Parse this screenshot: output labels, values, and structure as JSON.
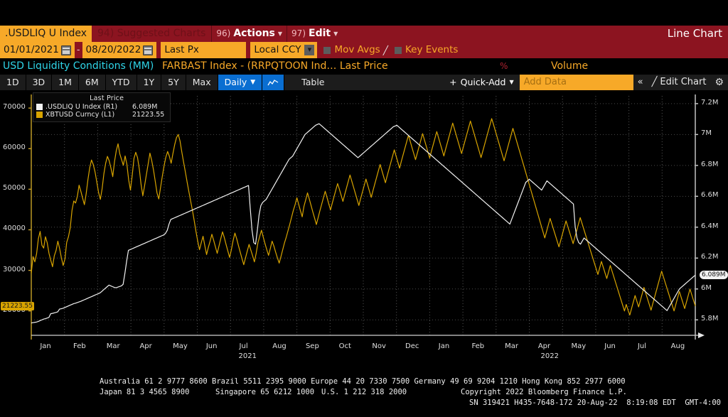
{
  "header": {
    "ticker": ".USDLIQ U Index",
    "suggested_charts": "94) Suggested Charts",
    "actions_num": "96)",
    "actions_label": "Actions",
    "edit_num": "97)",
    "edit_label": "Edit",
    "right_label": "Line Chart"
  },
  "options": {
    "date_from": "01/01/2021",
    "date_sep": "-",
    "date_to": "08/20/2022",
    "price_type": "Last Px",
    "currency": "Local CCY",
    "mov_avgs": "Mov Avgs",
    "key_events": "Key Events"
  },
  "titles": {
    "left": "USD Liquidity Conditions (MM)",
    "center": "FARBAST Index - (RRPQTOON Ind…  Last Price",
    "percent": "%",
    "volume": "Volume"
  },
  "toolbar": {
    "periods": [
      "1D",
      "3D",
      "1M",
      "6M",
      "YTD",
      "1Y",
      "5Y",
      "Max"
    ],
    "interval": "Daily",
    "chart_icon": "line-chart-icon",
    "table": "Table",
    "quick_add": "Quick-Add",
    "add_data_placeholder": "Add Data",
    "collapse": "«",
    "edit_chart": "Edit Chart",
    "settings": "gear-icon"
  },
  "legend": {
    "header": "Last Price",
    "series": [
      {
        "color": "#f2f2f2",
        "name": ".USDLIQ U Index  (R1)",
        "value": "6.089M"
      },
      {
        "color": "#d8a400",
        "name": "XBTUSD Curncy  (L1)",
        "value": "21223.55"
      }
    ]
  },
  "axes": {
    "left_ticks": [
      "70000",
      "60000",
      "50000",
      "40000",
      "30000",
      "20000"
    ],
    "right_ticks": [
      "7.2M",
      "7M",
      "6.8M",
      "6.6M",
      "6.4M",
      "6.2M",
      "6M",
      "5.8M"
    ],
    "left_tag": "21223.55",
    "right_tag": "6.089M",
    "x_ticks": [
      "Jan",
      "Feb",
      "Mar",
      "Apr",
      "May",
      "Jun",
      "Jul",
      "Aug",
      "Sep",
      "Oct",
      "Nov",
      "Dec",
      "Jan",
      "Feb",
      "Mar",
      "Apr",
      "May",
      "Jun",
      "Jul",
      "Aug"
    ],
    "year_labels": [
      "2021",
      "2022"
    ]
  },
  "footer": {
    "line1": "Australia 61 2 9777 8600 Brazil 5511 2395 9000 Europe 44 20 7330 7500 Germany 49 69 9204 1210 Hong Kong 852 2977 6000",
    "line2a": "Japan 81 3 4565 8900",
    "line2b": "Singapore 65 6212 1000",
    "line2c": "U.S. 1 212 318 2000",
    "line2d": "Copyright 2022 Bloomberg Finance L.P.",
    "line3": "SN 319421 H435-7648-172 20-Aug-22  8:19:08 EDT  GMT-4:00"
  },
  "chart_data": {
    "type": "line",
    "title": "USD Liquidity Conditions (MM)",
    "xlabel": "",
    "ylabel_left": "XBTUSD Curncy",
    "ylabel_right": ".USDLIQ U Index",
    "grid": true,
    "legend_position": "top-left",
    "x_range": [
      "2021-01-01",
      "2022-08-20"
    ],
    "left_axis": {
      "min": 14000,
      "max": 73000,
      "ticks": [
        20000,
        30000,
        40000,
        50000,
        60000,
        70000
      ]
    },
    "right_axis": {
      "min": 5700000,
      "max": 7250000,
      "ticks": [
        5800000,
        6000000,
        6200000,
        6400000,
        6600000,
        6800000,
        7000000,
        7200000
      ]
    },
    "series": [
      {
        "name": "XBTUSD Curncy (L1)",
        "axis": "left",
        "color": "#d8a400",
        "last_value": 21223.55,
        "values": [
          29300,
          33400,
          32100,
          34100,
          37800,
          39600,
          36200,
          35500,
          38300,
          36800,
          34200,
          32500,
          30900,
          33600,
          34900,
          37200,
          35400,
          33100,
          31200,
          32800,
          36900,
          38300,
          40500,
          44800,
          47100,
          46600,
          48200,
          51000,
          49500,
          47800,
          46200,
          48900,
          52400,
          55300,
          57200,
          56100,
          54300,
          51800,
          49200,
          47500,
          50100,
          53800,
          56400,
          58100,
          57000,
          55200,
          53100,
          56800,
          59500,
          61200,
          58700,
          57300,
          55900,
          58200,
          56100,
          52300,
          49800,
          53400,
          57600,
          59100,
          57800,
          55000,
          51200,
          48400,
          50900,
          53600,
          56200,
          58900,
          57100,
          54800,
          52000,
          49100,
          47600,
          50400,
          53200,
          55800,
          57900,
          59300,
          58100,
          56400,
          58800,
          61000,
          62700,
          63500,
          61900,
          59200,
          56700,
          54300,
          51800,
          49400,
          47100,
          44800,
          42300,
          39600,
          37200,
          35100,
          36800,
          38400,
          36100,
          33900,
          35700,
          37200,
          38900,
          37400,
          35800,
          34200,
          36000,
          37800,
          39500,
          38100,
          36400,
          34800,
          33200,
          35100,
          37400,
          39200,
          37800,
          36100,
          34500,
          32900,
          31400,
          33100,
          34800,
          36400,
          35000,
          33600,
          32100,
          34200,
          36800,
          38400,
          39900,
          38200,
          36600,
          35100,
          33700,
          35400,
          37200,
          36000,
          34500,
          33100,
          31800,
          33400,
          35100,
          36800,
          38200,
          39800,
          41400,
          43100,
          44800,
          46200,
          47900,
          46300,
          44700,
          43200,
          45800,
          47400,
          49100,
          47600,
          46000,
          44400,
          42900,
          41300,
          43000,
          44700,
          46300,
          47900,
          49500,
          48000,
          46400,
          44900,
          46600,
          48200,
          49800,
          51400,
          50000,
          48500,
          47000,
          48700,
          50300,
          51900,
          53500,
          52000,
          50500,
          49000,
          47500,
          46000,
          47700,
          49300,
          50900,
          52500,
          51000,
          49500,
          48000,
          49700,
          51300,
          52900,
          54500,
          56100,
          54600,
          53100,
          51600,
          53300,
          54900,
          56500,
          58100,
          59700,
          58200,
          56700,
          55200,
          56900,
          58500,
          60100,
          61700,
          63300,
          61800,
          60300,
          58800,
          57300,
          58900,
          60500,
          62100,
          63700,
          62200,
          60700,
          59200,
          57700,
          59400,
          61000,
          62600,
          64200,
          62700,
          61200,
          59700,
          58200,
          59900,
          61500,
          63100,
          64700,
          66300,
          64800,
          63300,
          61800,
          60300,
          58800,
          60400,
          62000,
          63600,
          65200,
          66800,
          65300,
          63800,
          62300,
          60800,
          59300,
          57800,
          59400,
          61000,
          62600,
          64200,
          65800,
          67400,
          66000,
          64500,
          63000,
          61500,
          60000,
          58500,
          57000,
          58600,
          60200,
          61800,
          63400,
          65000,
          63500,
          62000,
          60500,
          59000,
          57500,
          56000,
          54500,
          53000,
          51500,
          50000,
          48500,
          47000,
          45500,
          44000,
          42500,
          41000,
          39500,
          38000,
          39600,
          41200,
          42800,
          41400,
          40000,
          38600,
          37200,
          35800,
          37400,
          39000,
          40600,
          42200,
          40800,
          39400,
          38000,
          36600,
          38200,
          39800,
          41400,
          43000,
          41600,
          40200,
          38800,
          37400,
          36000,
          34600,
          33200,
          31800,
          30400,
          29000,
          30600,
          32200,
          30800,
          29400,
          28000,
          29600,
          31200,
          29800,
          28400,
          27000,
          25600,
          24200,
          22800,
          21400,
          20000,
          21600,
          20200,
          19000,
          20600,
          22200,
          23800,
          22400,
          21000,
          22600,
          24200,
          25800,
          24400,
          23000,
          21600,
          20200,
          21800,
          23400,
          25000,
          26600,
          28200,
          29800,
          28400,
          27000,
          25600,
          24200,
          22800,
          21400,
          20000,
          21600,
          23200,
          24800,
          23400,
          22000,
          20600,
          22200,
          23800,
          25400,
          24000,
          22600,
          21223
        ]
      },
      {
        "name": ".USDLIQ U Index (R1)",
        "axis": "right",
        "color": "#f2f2f2",
        "last_value": 6089000,
        "values": [
          5780000,
          5782000,
          5784000,
          5786000,
          5790000,
          5795000,
          5800000,
          5805000,
          5808000,
          5812000,
          5816000,
          5840000,
          5842000,
          5845000,
          5848000,
          5852000,
          5870000,
          5872000,
          5875000,
          5880000,
          5885000,
          5890000,
          5895000,
          5900000,
          5905000,
          5908000,
          5912000,
          5916000,
          5920000,
          5925000,
          5930000,
          5935000,
          5940000,
          5945000,
          5950000,
          5955000,
          5960000,
          5965000,
          5970000,
          5975000,
          5985000,
          5995000,
          6005000,
          6015000,
          6025000,
          6020000,
          6015000,
          6010000,
          6008000,
          6012000,
          6016000,
          6020000,
          6030000,
          6100000,
          6180000,
          6250000,
          6255000,
          6260000,
          6265000,
          6270000,
          6275000,
          6280000,
          6285000,
          6290000,
          6295000,
          6300000,
          6305000,
          6310000,
          6315000,
          6320000,
          6325000,
          6330000,
          6335000,
          6340000,
          6345000,
          6350000,
          6360000,
          6380000,
          6420000,
          6450000,
          6455000,
          6460000,
          6465000,
          6470000,
          6475000,
          6480000,
          6485000,
          6490000,
          6495000,
          6500000,
          6505000,
          6510000,
          6515000,
          6520000,
          6525000,
          6530000,
          6535000,
          6540000,
          6545000,
          6550000,
          6555000,
          6560000,
          6565000,
          6570000,
          6575000,
          6580000,
          6585000,
          6590000,
          6595000,
          6600000,
          6605000,
          6610000,
          6615000,
          6620000,
          6625000,
          6630000,
          6635000,
          6640000,
          6645000,
          6650000,
          6655000,
          6660000,
          6665000,
          6670000,
          6520000,
          6380000,
          6300000,
          6290000,
          6380000,
          6480000,
          6540000,
          6560000,
          6570000,
          6580000,
          6600000,
          6620000,
          6640000,
          6660000,
          6680000,
          6700000,
          6720000,
          6740000,
          6760000,
          6780000,
          6800000,
          6820000,
          6840000,
          6850000,
          6860000,
          6880000,
          6900000,
          6920000,
          6940000,
          6960000,
          6980000,
          7000000,
          7010000,
          7020000,
          7030000,
          7040000,
          7050000,
          7060000,
          7065000,
          7070000,
          7060000,
          7050000,
          7040000,
          7030000,
          7020000,
          7010000,
          7000000,
          6990000,
          6980000,
          6970000,
          6960000,
          6950000,
          6940000,
          6930000,
          6920000,
          6910000,
          6900000,
          6890000,
          6880000,
          6870000,
          6860000,
          6850000,
          6860000,
          6870000,
          6880000,
          6890000,
          6900000,
          6910000,
          6920000,
          6930000,
          6940000,
          6950000,
          6960000,
          6970000,
          6980000,
          6990000,
          7000000,
          7010000,
          7020000,
          7030000,
          7040000,
          7050000,
          7055000,
          7060000,
          7050000,
          7040000,
          7030000,
          7020000,
          7010000,
          7000000,
          6990000,
          6980000,
          6970000,
          6960000,
          6950000,
          6940000,
          6930000,
          6920000,
          6910000,
          6900000,
          6890000,
          6880000,
          6870000,
          6860000,
          6850000,
          6840000,
          6830000,
          6820000,
          6810000,
          6800000,
          6790000,
          6780000,
          6770000,
          6760000,
          6750000,
          6740000,
          6730000,
          6720000,
          6710000,
          6700000,
          6690000,
          6680000,
          6670000,
          6660000,
          6650000,
          6640000,
          6630000,
          6620000,
          6610000,
          6600000,
          6590000,
          6580000,
          6570000,
          6560000,
          6550000,
          6540000,
          6530000,
          6520000,
          6510000,
          6500000,
          6490000,
          6480000,
          6470000,
          6460000,
          6450000,
          6440000,
          6430000,
          6420000,
          6450000,
          6480000,
          6510000,
          6540000,
          6570000,
          6600000,
          6630000,
          6660000,
          6690000,
          6700000,
          6710000,
          6700000,
          6690000,
          6680000,
          6670000,
          6660000,
          6650000,
          6640000,
          6660000,
          6680000,
          6700000,
          6690000,
          6680000,
          6670000,
          6660000,
          6650000,
          6640000,
          6630000,
          6620000,
          6610000,
          6600000,
          6590000,
          6580000,
          6570000,
          6560000,
          6550000,
          6400000,
          6330000,
          6300000,
          6290000,
          6310000,
          6330000,
          6320000,
          6310000,
          6300000,
          6290000,
          6280000,
          6270000,
          6260000,
          6250000,
          6240000,
          6230000,
          6220000,
          6210000,
          6200000,
          6190000,
          6180000,
          6170000,
          6160000,
          6150000,
          6140000,
          6130000,
          6120000,
          6110000,
          6100000,
          6090000,
          6080000,
          6070000,
          6060000,
          6050000,
          6040000,
          6030000,
          6020000,
          6010000,
          6000000,
          5990000,
          5980000,
          5970000,
          5960000,
          5950000,
          5940000,
          5930000,
          5920000,
          5910000,
          5900000,
          5890000,
          5880000,
          5870000,
          5860000,
          5880000,
          5900000,
          5920000,
          5940000,
          5960000,
          5980000,
          6000000,
          6010000,
          6020000,
          6030000,
          6040000,
          6050000,
          6060000,
          6070000,
          6080000,
          6089000
        ]
      }
    ]
  }
}
